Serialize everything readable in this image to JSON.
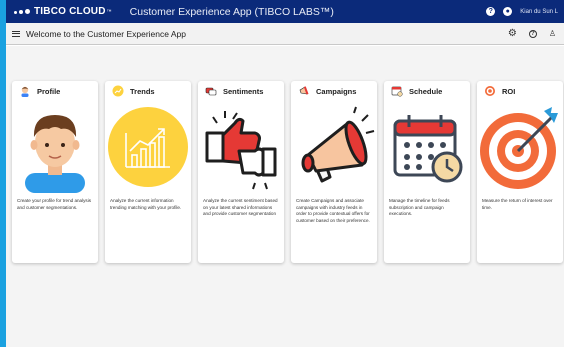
{
  "app": {
    "brand": "TIBCO CLOUD",
    "trademark": "™",
    "title": "Customer Experience App (TIBCO LABS™)",
    "user": "Kian du Sun L"
  },
  "subheader": {
    "welcome": "Welcome to the Customer Experience App"
  },
  "cards": [
    {
      "title": "Profile",
      "icon": "person-icon",
      "desc": "Create your profile for trend analysis and customer segmentations."
    },
    {
      "title": "Trends",
      "icon": "trend-chart-icon",
      "desc": "Analyze the current information trending matching with your profile."
    },
    {
      "title": "Sentiments",
      "icon": "thumbs-up-down-icon",
      "desc": "Analyze the current sentiment based on your latest shared informations and provide customer segmentation"
    },
    {
      "title": "Campaigns",
      "icon": "megaphone-icon",
      "desc": "Create Campaigns and associate campaigns with industry feeds in order to provide contextual offers for customer based on their preference."
    },
    {
      "title": "Schedule",
      "icon": "calendar-clock-icon",
      "desc": "Manage the timeline for feeds subscription and campaign executions."
    },
    {
      "title": "ROI",
      "icon": "target-icon",
      "desc": "Measure the return of interest over time."
    }
  ],
  "colors": {
    "topbar": "#0b2a7a",
    "accent": "#1aa1e0",
    "trends_circle": "#fdd23e",
    "sentiment_red": "#e53935",
    "roi_orange": "#f26b3a"
  }
}
